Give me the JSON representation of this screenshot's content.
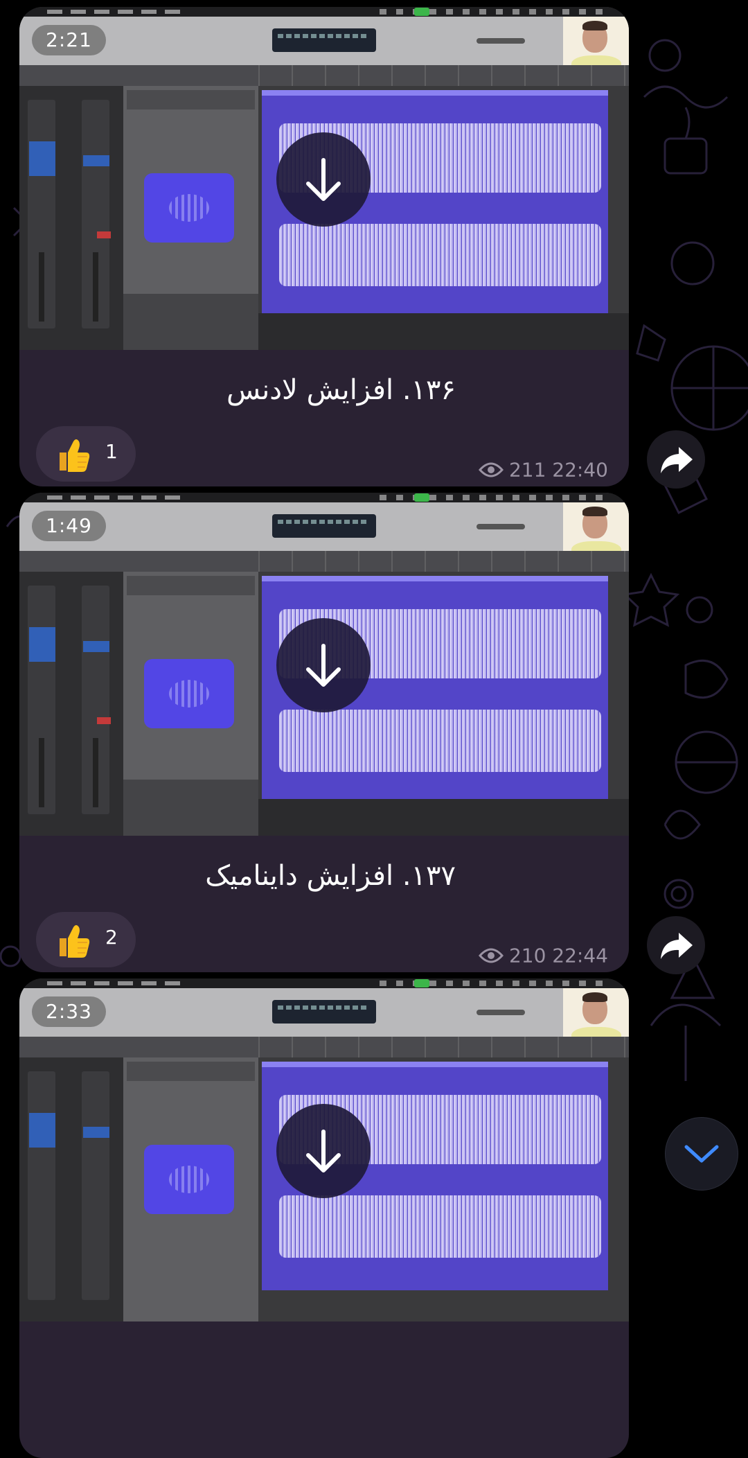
{
  "messages": [
    {
      "duration": "2:21",
      "caption": "۱۳۶. افزایش لادنس",
      "reaction_emoji": "👍",
      "reaction_count": "1",
      "views": "211",
      "time": "22:40"
    },
    {
      "duration": "1:49",
      "caption": "۱۳۷. افزایش داینامیک",
      "reaction_emoji": "👍",
      "reaction_count": "2",
      "views": "210",
      "time": "22:44"
    },
    {
      "duration": "2:33"
    }
  ],
  "icons": {
    "download": "download-arrow-icon",
    "forward": "forward-arrow-icon",
    "views": "eye-icon",
    "scroll_down": "chevron-down-icon"
  },
  "colors": {
    "bubble": "#2a2233",
    "accent": "#3f8bff",
    "waveform_region": "#5345c8",
    "meta_text": "#9b93a3"
  }
}
